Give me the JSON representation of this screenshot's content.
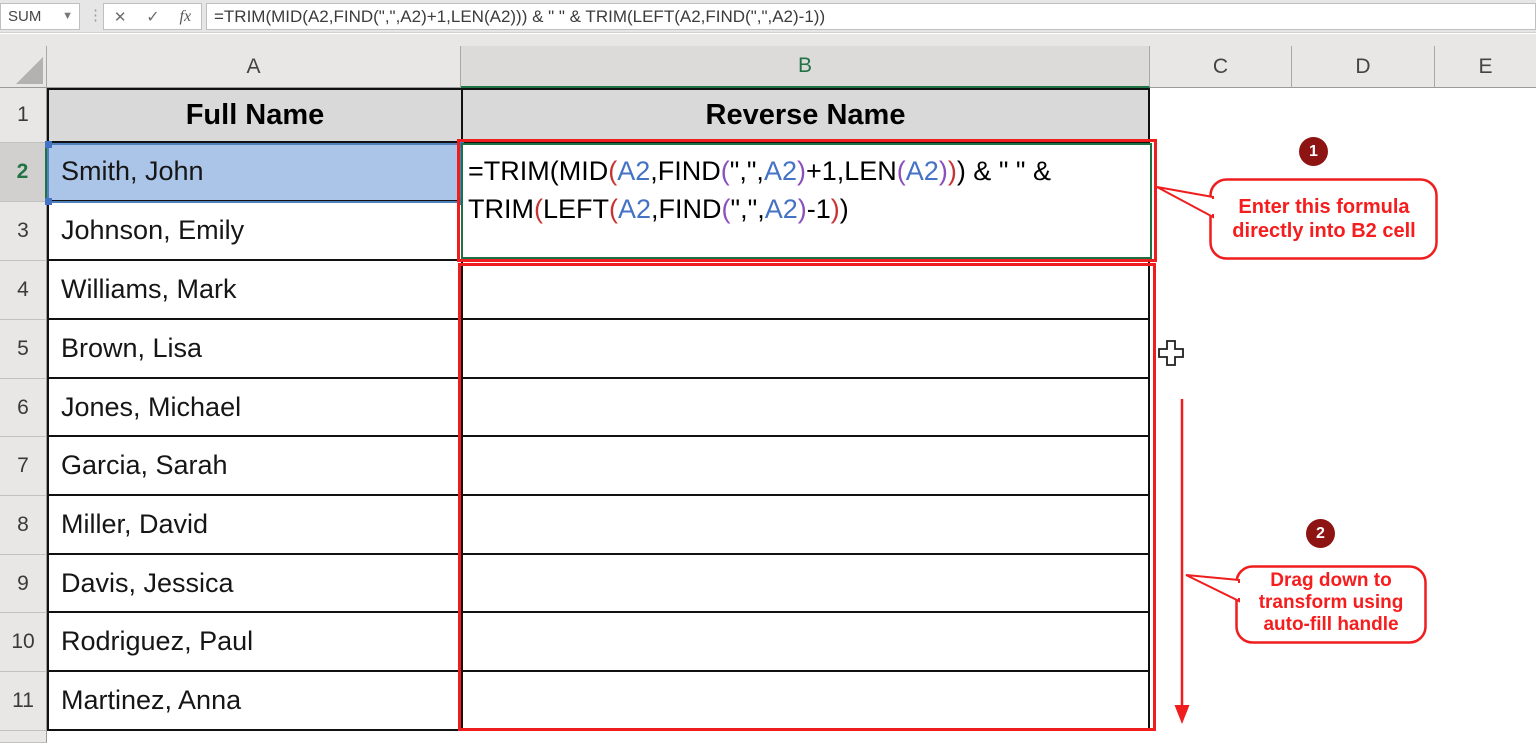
{
  "formula_bar": {
    "name_box_value": "SUM",
    "cancel_label": "✕",
    "enter_label": "✓",
    "fx_label": "fx",
    "formula_text": "=TRIM(MID(A2,FIND(\",\",A2)+1,LEN(A2))) & \" \" & TRIM(LEFT(A2,FIND(\",\",A2)-1))"
  },
  "grid": {
    "column_headers": [
      "A",
      "B",
      "C",
      "D",
      "E"
    ],
    "active_column": "B",
    "row_numbers": [
      "1",
      "2",
      "3",
      "4",
      "5",
      "6",
      "7",
      "8",
      "9",
      "10",
      "11"
    ],
    "active_row": "2",
    "active_cell": "A2"
  },
  "table": {
    "full_name_header": "Full Name",
    "reverse_name_header": "Reverse Name",
    "names": [
      "Smith, John",
      "Johnson, Emily",
      "Williams, Mark",
      "Brown, Lisa",
      "Jones, Michael",
      "Garcia, Sarah",
      "Miller, David",
      "Davis, Jessica",
      "Rodriguez, Paul",
      "Martinez, Anna"
    ]
  },
  "b2_formula": {
    "lines": [
      [
        {
          "t": "=TRIM(MID",
          "c": "black"
        },
        {
          "t": "(",
          "c": "red"
        },
        {
          "t": "A2",
          "c": "blue"
        },
        {
          "t": ",FIND",
          "c": "black"
        },
        {
          "t": "(",
          "c": "purple"
        },
        {
          "t": "\",\",",
          "c": "black"
        },
        {
          "t": "A2",
          "c": "blue"
        },
        {
          "t": ")",
          "c": "purple"
        },
        {
          "t": "+1,LEN",
          "c": "black"
        },
        {
          "t": "(",
          "c": "purple"
        },
        {
          "t": "A2",
          "c": "blue"
        },
        {
          "t": ")",
          "c": "purple"
        },
        {
          "t": ")",
          "c": "red"
        },
        {
          "t": ") & \" \" &",
          "c": "black"
        }
      ],
      [
        {
          "t": "TRIM",
          "c": "black"
        },
        {
          "t": "(",
          "c": "red"
        },
        {
          "t": "LEFT",
          "c": "black"
        },
        {
          "t": "(",
          "c": "red"
        },
        {
          "t": "A2",
          "c": "blue"
        },
        {
          "t": ",FIND",
          "c": "black"
        },
        {
          "t": "(",
          "c": "purple"
        },
        {
          "t": "\",\",",
          "c": "black"
        },
        {
          "t": "A2",
          "c": "blue"
        },
        {
          "t": ")",
          "c": "purple"
        },
        {
          "t": "-1",
          "c": "black"
        },
        {
          "t": ")",
          "c": "red"
        },
        {
          "t": ")",
          "c": "black"
        }
      ]
    ]
  },
  "annotations": {
    "callout1": {
      "badge": "1",
      "line1": "Enter this formula",
      "line2": "directly into B2 cell"
    },
    "callout2": {
      "badge": "2",
      "line1": "Drag down to",
      "line2": "transform using",
      "line3": "auto-fill handle"
    }
  },
  "colors": {
    "annotation_red": "#ef1d1d",
    "badge_maroon": "#8e1313",
    "excel_green": "#217346",
    "reference_blue": "#4472c4",
    "reference_fill": "#abc5e8",
    "paren_red": "#c83434",
    "paren_purple": "#8950be",
    "table_header_gray": "#d9d9d9"
  }
}
